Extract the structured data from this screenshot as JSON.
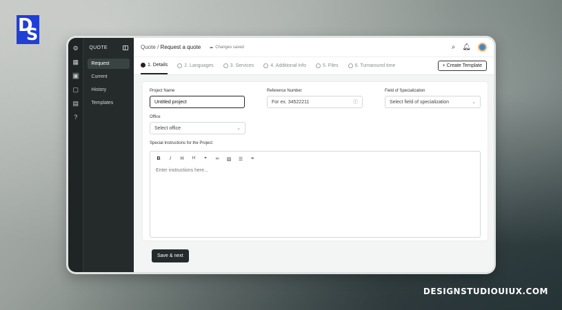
{
  "sidebar": {
    "title": "QUOTE",
    "items": [
      {
        "label": "Request",
        "active": true
      },
      {
        "label": "Current",
        "active": false
      },
      {
        "label": "History",
        "active": false
      },
      {
        "label": "Templates",
        "active": false
      }
    ]
  },
  "header": {
    "breadcrumb_root": "Quote /",
    "breadcrumb_current": "Request a quote",
    "saved_status": "Changes saved"
  },
  "tabs": [
    {
      "label": "1. Details",
      "active": true
    },
    {
      "label": "2. Languages",
      "active": false
    },
    {
      "label": "3. Services",
      "active": false
    },
    {
      "label": "4. Additional Info",
      "active": false
    },
    {
      "label": "5. Files",
      "active": false
    },
    {
      "label": "6. Turnaround time",
      "active": false
    }
  ],
  "create_template_label": "+ Create Template",
  "form": {
    "project_name": {
      "label": "Project Name",
      "value": "Untitled project"
    },
    "reference_number": {
      "label": "Reference Number",
      "placeholder": "For ex. 34522211"
    },
    "field_of_specialization": {
      "label": "Field of Specialization",
      "value": "Select field of specialization"
    },
    "office": {
      "label": "Office",
      "value": "Select office"
    },
    "special_instructions": {
      "label": "Special Instructions for the Project",
      "placeholder": "Enter instructions here..."
    },
    "save_next_label": "Save & next"
  },
  "overlay": {
    "brand_text": "DESIGNSTUDIOUIUX.COM",
    "logo_letters": {
      "d": "D",
      "s": "S"
    }
  },
  "colors": {
    "sidebar_bg": "#252b2b",
    "logo_blue": "#1f3fd6",
    "accent_dark": "#222222"
  }
}
